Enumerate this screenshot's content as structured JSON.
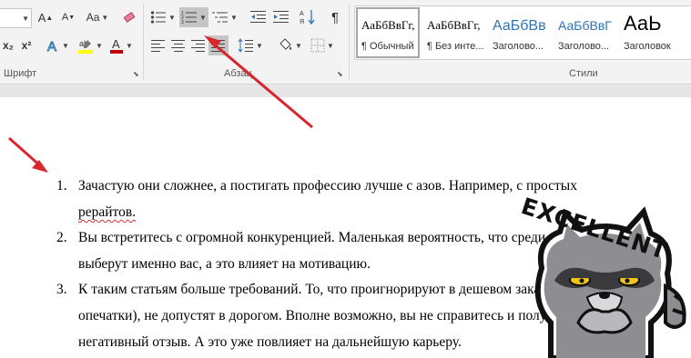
{
  "ribbon": {
    "groups": {
      "font": "Шрифт",
      "paragraph": "Абзац",
      "styles": "Стили"
    },
    "font_buttons": {
      "change_case": "Aa",
      "subscript": "x₂",
      "superscript": "x²"
    },
    "styles_gallery": [
      {
        "preview": "АаБбВвГг,",
        "name": "¶ Обычный",
        "selected": true
      },
      {
        "preview": "АаБбВвГг,",
        "name": "¶ Без инте...",
        "selected": false
      },
      {
        "preview": "АаБбВв",
        "name": "Заголово...",
        "selected": false
      },
      {
        "preview": "АаБбВвГ",
        "name": "Заголово...",
        "selected": false
      },
      {
        "preview": "АаЬ",
        "name": "Заголовок",
        "selected": false
      }
    ],
    "active_button": "numbering"
  },
  "document": {
    "list": [
      {
        "number": "1.",
        "lines": [
          "Зачастую они сложнее, а постигать профессию лучше с азов. Например, с простых",
          "рерайтов."
        ]
      },
      {
        "number": "2.",
        "lines": [
          "Вы встретитесь с огромной конкуренцией. Маленькая вероятность, что среди всех",
          "выберут именно вас, а это влияет на мотивацию."
        ]
      },
      {
        "number": "3.",
        "lines": [
          "К таким статьям больше требований. То, что проигнорируют в дешевом заказе (к",
          "опечатки), не допустят в дорогом. Вполне возможно, вы не справитесь и получите",
          "негативный отзыв. А это уже повлияет на дальнейшую карьеру."
        ]
      }
    ]
  },
  "sticker": {
    "text": "EXCELLENT"
  },
  "colors": {
    "arrow": "#d9262c",
    "heading_style": "#2e74b5",
    "highlight": "#ffff00",
    "font_color": "#c00000"
  }
}
